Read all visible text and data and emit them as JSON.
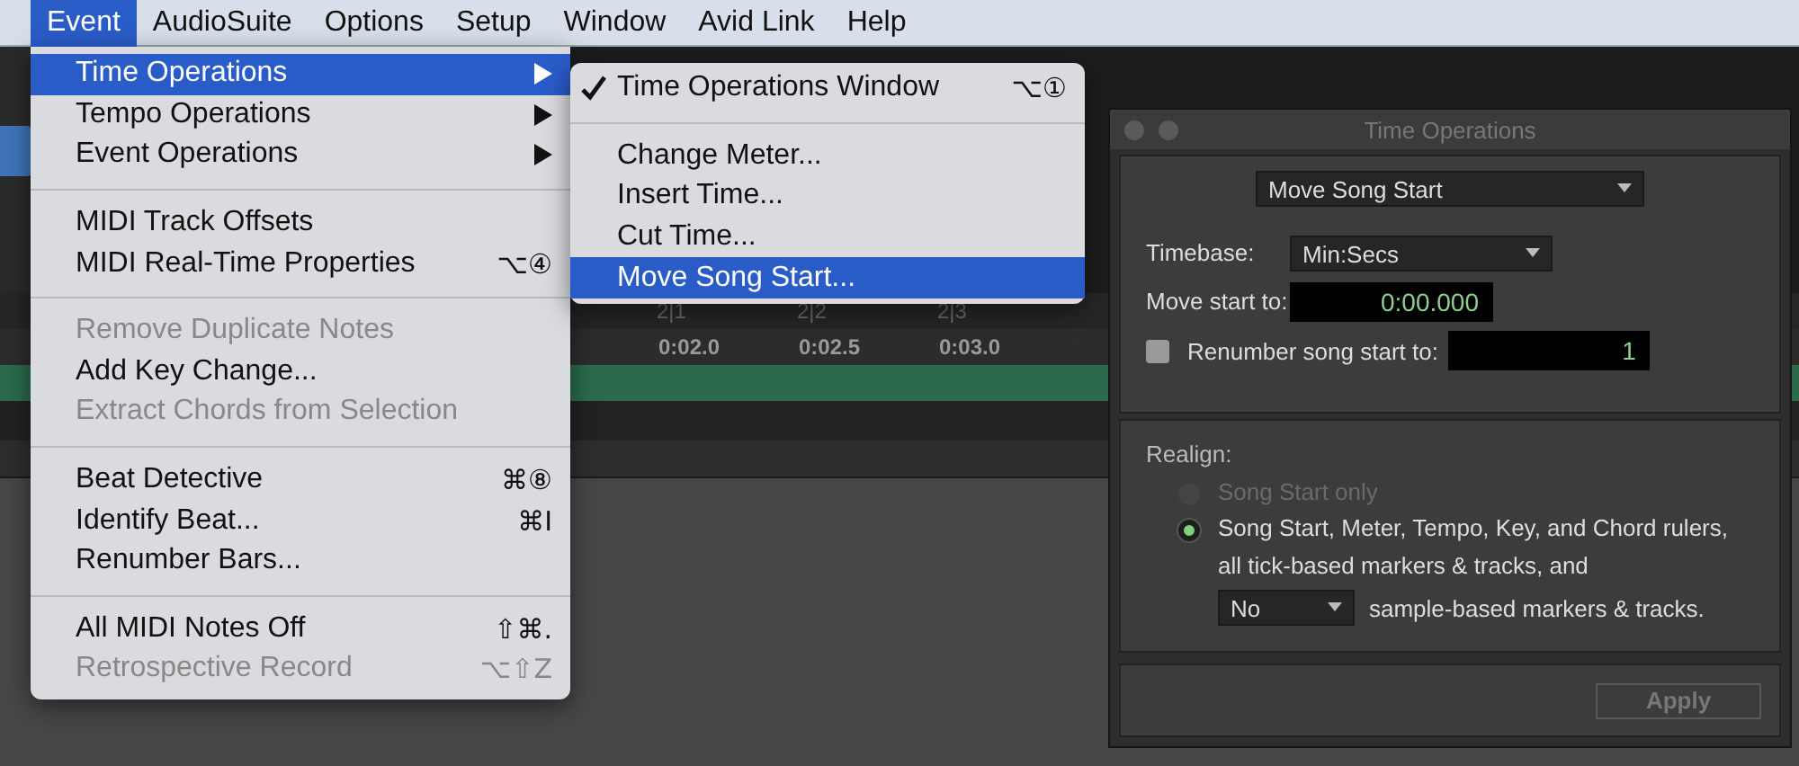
{
  "menu_bar": [
    {
      "label": "Event",
      "selected": true
    },
    {
      "label": "AudioSuite",
      "selected": false
    },
    {
      "label": "Options",
      "selected": false
    },
    {
      "label": "Setup",
      "selected": false
    },
    {
      "label": "Window",
      "selected": false
    },
    {
      "label": "Avid Link",
      "selected": false
    },
    {
      "label": "Help",
      "selected": false
    }
  ],
  "timeline": {
    "bars": [
      "2|1",
      "2|2",
      "2|3"
    ],
    "times": [
      "0:02.0",
      "0:02.5",
      "0:03.0"
    ]
  },
  "event_menu": [
    [
      {
        "label": "Time Operations",
        "submenu": true,
        "selected": true,
        "disabled": false
      },
      {
        "label": "Tempo Operations",
        "submenu": true,
        "selected": false,
        "disabled": false
      },
      {
        "label": "Event Operations",
        "submenu": true,
        "selected": false,
        "disabled": false
      }
    ],
    [
      {
        "label": "MIDI Track Offsets",
        "submenu": false,
        "selected": false,
        "disabled": false
      },
      {
        "label": "MIDI Real-Time Properties",
        "shortcut": "⌥④",
        "submenu": false,
        "selected": false,
        "disabled": false
      }
    ],
    [
      {
        "label": "Remove Duplicate Notes",
        "submenu": false,
        "selected": false,
        "disabled": true
      },
      {
        "label": "Add Key Change...",
        "submenu": false,
        "selected": false,
        "disabled": false
      },
      {
        "label": "Extract Chords from Selection",
        "submenu": false,
        "selected": false,
        "disabled": true
      }
    ],
    [
      {
        "label": "Beat Detective",
        "shortcut": "⌘⑧",
        "submenu": false,
        "selected": false,
        "disabled": false
      },
      {
        "label": "Identify Beat...",
        "shortcut": "⌘I",
        "submenu": false,
        "selected": false,
        "disabled": false
      },
      {
        "label": "Renumber Bars...",
        "submenu": false,
        "selected": false,
        "disabled": false
      }
    ],
    [
      {
        "label": "All MIDI Notes Off",
        "shortcut": "⇧⌘.",
        "submenu": false,
        "selected": false,
        "disabled": false
      },
      {
        "label": "Retrospective Record",
        "shortcut": "⌥⇧Z",
        "submenu": false,
        "selected": false,
        "disabled": true
      }
    ]
  ],
  "time_operations_menu": [
    [
      {
        "label": "Time Operations Window",
        "shortcut": "⌥①",
        "checked": true,
        "selected": false
      }
    ],
    [
      {
        "label": "Change Meter...",
        "checked": false,
        "selected": false
      },
      {
        "label": "Insert Time...",
        "checked": false,
        "selected": false
      },
      {
        "label": "Cut Time...",
        "checked": false,
        "selected": false
      },
      {
        "label": "Move Song Start...",
        "checked": false,
        "selected": true
      }
    ]
  ],
  "dialog": {
    "title": "Time Operations",
    "operation": "Move Song Start",
    "timebase": {
      "label": "Timebase:",
      "value": "Min:Secs"
    },
    "move_start": {
      "label": "Move start to:",
      "value": "0:00.000"
    },
    "renumber": {
      "label": "Renumber song start to:",
      "checked": false,
      "value": "1"
    },
    "realign": {
      "label": "Realign:",
      "options": [
        {
          "label": "Song Start only",
          "selected": false,
          "disabled": true
        },
        {
          "label": "Song Start, Meter, Tempo, Key, and Chord rulers,",
          "line2": "all tick-based markers & tracks, and",
          "selected": true,
          "disabled": false
        }
      ],
      "sample_based": {
        "value": "No",
        "label": "sample-based markers & tracks."
      }
    },
    "apply_button": {
      "label": "Apply",
      "disabled": true
    }
  }
}
